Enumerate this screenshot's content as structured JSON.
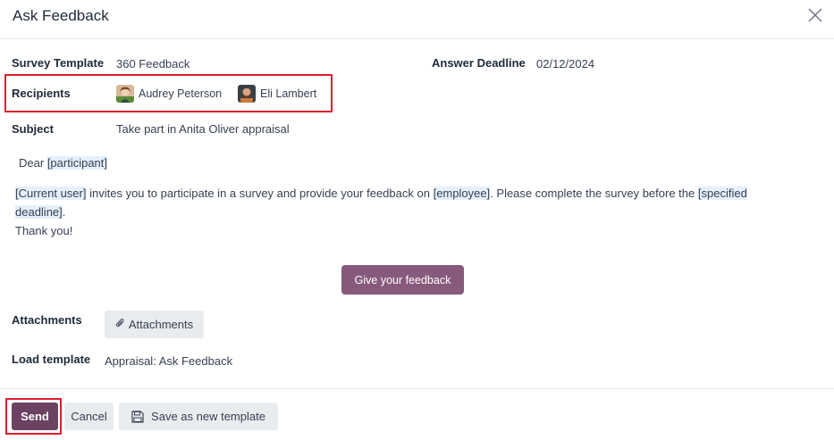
{
  "dialog": {
    "title": "Ask Feedback"
  },
  "form": {
    "survey_template_label": "Survey Template",
    "survey_template_value": "360 Feedback",
    "answer_deadline_label": "Answer Deadline",
    "answer_deadline_value": "02/12/2024",
    "recipients_label": "Recipients",
    "recipients": [
      {
        "name": "Audrey Peterson"
      },
      {
        "name": "Eli Lambert"
      }
    ],
    "subject_label": "Subject",
    "subject_value": "Take part in Anita Oliver appraisal"
  },
  "body": {
    "dear": "Dear",
    "participant": "[participant]",
    "current_user": "[Current user]",
    "invite_text": "invites you to participate in a survey and provide your feedback on",
    "employee": "[employee]",
    "complete_text": ". Please complete the survey before the",
    "specified": "[specified",
    "deadline": "deadline]",
    "period": ".",
    "thanks": "Thank you!",
    "feedback_button": "Give your feedback"
  },
  "attachments": {
    "label": "Attachments",
    "button": "Attachments"
  },
  "load_template": {
    "label": "Load template",
    "value": "Appraisal: Ask Feedback"
  },
  "footer": {
    "send": "Send",
    "cancel": "Cancel",
    "save_template": "Save as new template"
  },
  "colors": {
    "primary": "#875a7b",
    "send": "#6b4262",
    "highlight": "#e11d2e",
    "placeholder_bg": "#e4f0fb"
  },
  "icons": {
    "close": "close-icon",
    "paperclip": "paperclip-icon",
    "save": "floppy-disk-icon"
  }
}
